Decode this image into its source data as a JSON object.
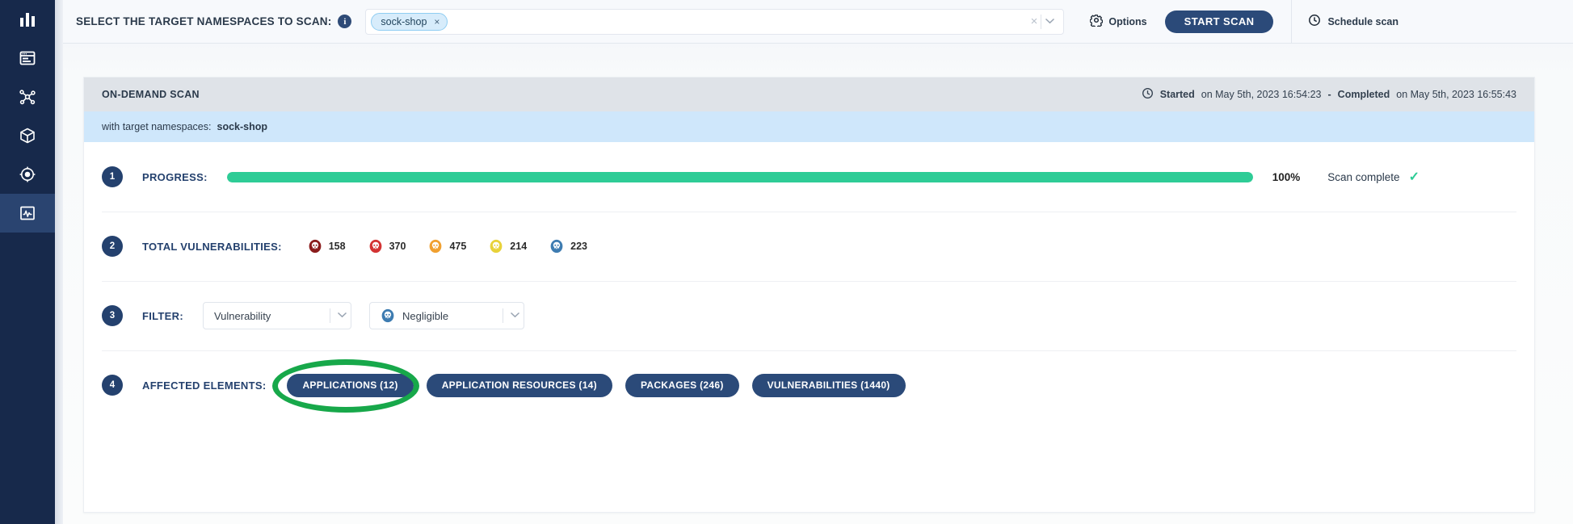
{
  "sidebar": {
    "items": [
      {
        "name": "dashboard-analytics",
        "icon": "bar-chart-icon",
        "active": false
      },
      {
        "name": "reports",
        "icon": "browser-window-icon",
        "active": false
      },
      {
        "name": "topology",
        "icon": "network-nodes-icon",
        "active": false
      },
      {
        "name": "packages",
        "icon": "package-box-icon",
        "active": false
      },
      {
        "name": "targets",
        "icon": "target-scan-icon",
        "active": false
      },
      {
        "name": "scan-monitor",
        "icon": "activity-monitor-icon",
        "active": true
      }
    ]
  },
  "topbar": {
    "label": "SELECT THE TARGET NAMESPACES TO SCAN:",
    "info_icon_char": "i",
    "namespace_chips": [
      {
        "label": "sock-shop",
        "remove": "×"
      }
    ],
    "clear_icon": "×",
    "dropdown_caret": "⌄",
    "options_label": "Options",
    "start_scan_label": "START SCAN",
    "schedule_label": "Schedule scan"
  },
  "card": {
    "title": "ON-DEMAND SCAN",
    "started_label": "Started",
    "started_value": "on May 5th, 2023 16:54:23",
    "separator": "-",
    "completed_label": "Completed",
    "completed_value": "on May 5th, 2023 16:55:43",
    "namespace_banner_label": "with target namespaces:",
    "namespace_banner_value": "sock-shop"
  },
  "progress": {
    "step": "1",
    "label": "PROGRESS:",
    "percent_value": 100,
    "percent_text": "100%",
    "status_text": "Scan complete",
    "check_char": "✓",
    "fill_color": "#2ecc96"
  },
  "vulnerabilities": {
    "step": "2",
    "label": "TOTAL VULNERABILITIES:",
    "severities": [
      {
        "name": "critical",
        "count": "158",
        "color": "#8a1c1c"
      },
      {
        "name": "high",
        "count": "370",
        "color": "#d33333"
      },
      {
        "name": "medium",
        "count": "475",
        "color": "#f0a030"
      },
      {
        "name": "low",
        "count": "214",
        "color": "#e8d23a"
      },
      {
        "name": "negligible",
        "count": "223",
        "color": "#3e7cb1"
      }
    ]
  },
  "filter": {
    "step": "3",
    "label": "FILTER:",
    "type_value": "Vulnerability",
    "severity_value": "Negligible",
    "severity_color": "#3e7cb1",
    "caret": "⌄"
  },
  "affected": {
    "step": "4",
    "label": "AFFECTED ELEMENTS:",
    "buttons": [
      {
        "name": "applications",
        "label": "APPLICATIONS (12)",
        "highlighted": true
      },
      {
        "name": "application-resources",
        "label": "APPLICATION RESOURCES (14)",
        "highlighted": false
      },
      {
        "name": "packages",
        "label": "PACKAGES (246)",
        "highlighted": false
      },
      {
        "name": "vulnerabilities",
        "label": "VULNERABILITIES (1440)",
        "highlighted": false
      }
    ],
    "highlight_color": "#17a84a"
  }
}
